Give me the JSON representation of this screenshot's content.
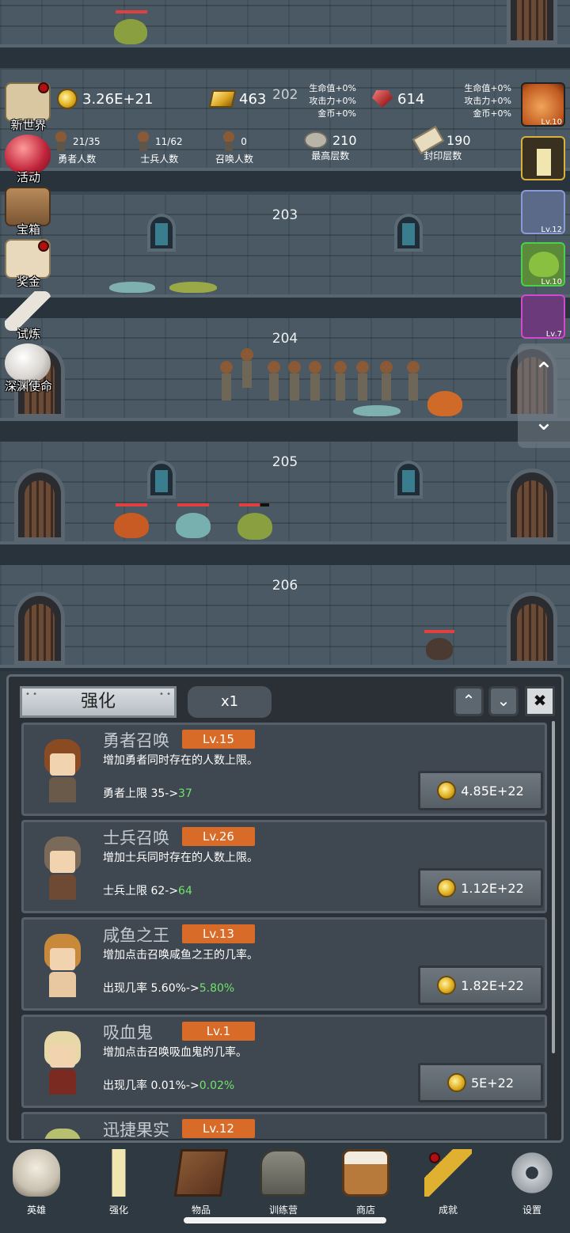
{
  "floors": [
    {
      "number": "203"
    },
    {
      "number": "204"
    },
    {
      "number": "205"
    },
    {
      "number": "206"
    }
  ],
  "hud": {
    "current_floor": "202",
    "gold": "3.26E+21",
    "gold_bar": "463",
    "ruby": "614",
    "bonus_left": [
      "生命值+0%",
      "攻击力+0%",
      "金币+0%"
    ],
    "bonus_right": [
      "生命值+0%",
      "攻击力+0%",
      "金币+0%"
    ],
    "stats": [
      {
        "value": "21/35",
        "label": "勇者人数",
        "icon": "hero-icon"
      },
      {
        "value": "11/62",
        "label": "士兵人数",
        "icon": "soldier-icon"
      },
      {
        "value": "0",
        "label": "召唤人数",
        "icon": "summon-icon"
      },
      {
        "value": "210",
        "label": "最高层数",
        "icon": "stone-icon"
      },
      {
        "value": "190",
        "label": "封印层数",
        "icon": "scroll-icon"
      }
    ]
  },
  "side_menu": [
    {
      "label": "新世界",
      "icon": "map-icon",
      "badge": true
    },
    {
      "label": "活动",
      "icon": "heart-icon",
      "badge": false
    },
    {
      "label": "宝箱",
      "icon": "chest-icon",
      "badge": false
    },
    {
      "label": "奖金",
      "icon": "envelope-icon",
      "badge": true
    },
    {
      "label": "试炼",
      "icon": "feather-icon",
      "badge": false
    },
    {
      "label": "深渊使命",
      "icon": "pearl-icon",
      "badge": false
    }
  ],
  "right_items": [
    {
      "icon": "peach-icon",
      "lv": "Lv.10"
    },
    {
      "icon": "candle-icon",
      "lv": ""
    },
    {
      "icon": "helmet-hero-icon",
      "lv": "Lv.12"
    },
    {
      "icon": "green-slime-icon",
      "lv": "Lv.10"
    },
    {
      "icon": "hero-portrait-icon",
      "lv": "Lv.7"
    }
  ],
  "panel": {
    "tab_label": "强化",
    "multiplier": "x1",
    "upgrades": [
      {
        "name": "勇者召唤",
        "level": "Lv.15",
        "desc": "增加勇者同时存在的人数上限。",
        "effect_prefix": "勇者上限 35->",
        "effect_new": "37",
        "cost": "4.85E+22",
        "hair": "#8a4a22",
        "body": "#6a5a4a"
      },
      {
        "name": "士兵召唤",
        "level": "Lv.26",
        "desc": "增加士兵同时存在的人数上限。",
        "effect_prefix": "士兵上限 62->",
        "effect_new": "64",
        "cost": "1.12E+22",
        "hair": "#7a6a5a",
        "body": "#6e4a34"
      },
      {
        "name": "咸鱼之王",
        "level": "Lv.13",
        "desc": "增加点击召唤咸鱼之王的几率。",
        "effect_prefix": "出现几率 5.60%->",
        "effect_new": "5.80%",
        "cost": "1.82E+22",
        "hair": "#c88a3a",
        "body": "#e8c8a0"
      },
      {
        "name": "吸血鬼",
        "level": "Lv.1",
        "desc": "增加点击召唤吸血鬼的几率。",
        "effect_prefix": "出现几率 0.01%->",
        "effect_new": "0.02%",
        "cost": "5E+22",
        "hair": "#e8d8a8",
        "body": "#7a2a20"
      },
      {
        "name": "迅捷果实",
        "level": "Lv.12",
        "desc": "",
        "effect_prefix": "",
        "effect_new": "",
        "cost": "",
        "hair": "#b8c070",
        "body": "#6a7a40"
      }
    ]
  },
  "nav": [
    {
      "label": "英雄",
      "icon": "skull-icon"
    },
    {
      "label": "强化",
      "icon": "candle-icon"
    },
    {
      "label": "物品",
      "icon": "book-icon"
    },
    {
      "label": "训练营",
      "icon": "lantern-icon"
    },
    {
      "label": "商店",
      "icon": "beer-mug-icon"
    },
    {
      "label": "成就",
      "icon": "key-icon",
      "badge": true
    },
    {
      "label": "设置",
      "icon": "gear-icon"
    }
  ]
}
